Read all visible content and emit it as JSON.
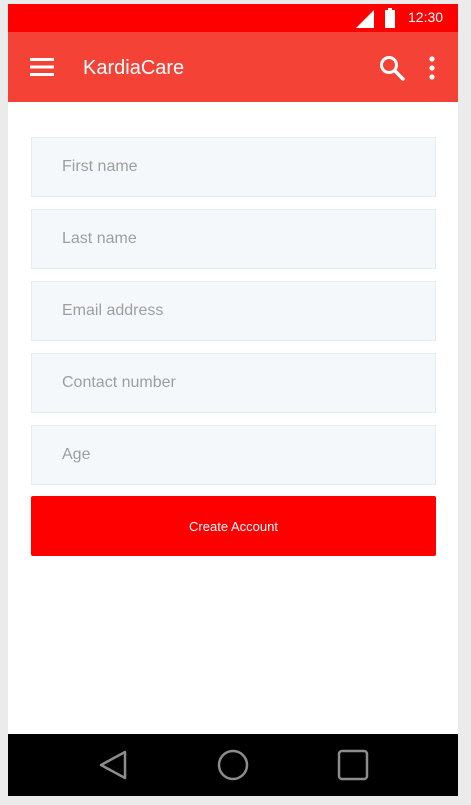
{
  "status_bar": {
    "time": "12:30",
    "background": "#ff0000",
    "signal_icon": "signal-icon",
    "battery_icon": "battery-icon"
  },
  "app_bar": {
    "title": "KardiaCare",
    "background": "#f44336",
    "menu_icon": "hamburger-menu-icon",
    "search_icon": "search-icon",
    "more_icon": "more-vert-icon"
  },
  "form": {
    "fields": [
      {
        "placeholder": "First name",
        "value": ""
      },
      {
        "placeholder": "Last name",
        "value": ""
      },
      {
        "placeholder": "Email address",
        "value": ""
      },
      {
        "placeholder": "Contact number",
        "value": ""
      },
      {
        "placeholder": "Age",
        "value": ""
      }
    ],
    "submit_label": "Create Account",
    "submit_color": "#ff0000"
  },
  "nav_bar": {
    "back_icon": "back-triangle-icon",
    "home_icon": "home-circle-icon",
    "recents_icon": "recents-square-icon"
  }
}
